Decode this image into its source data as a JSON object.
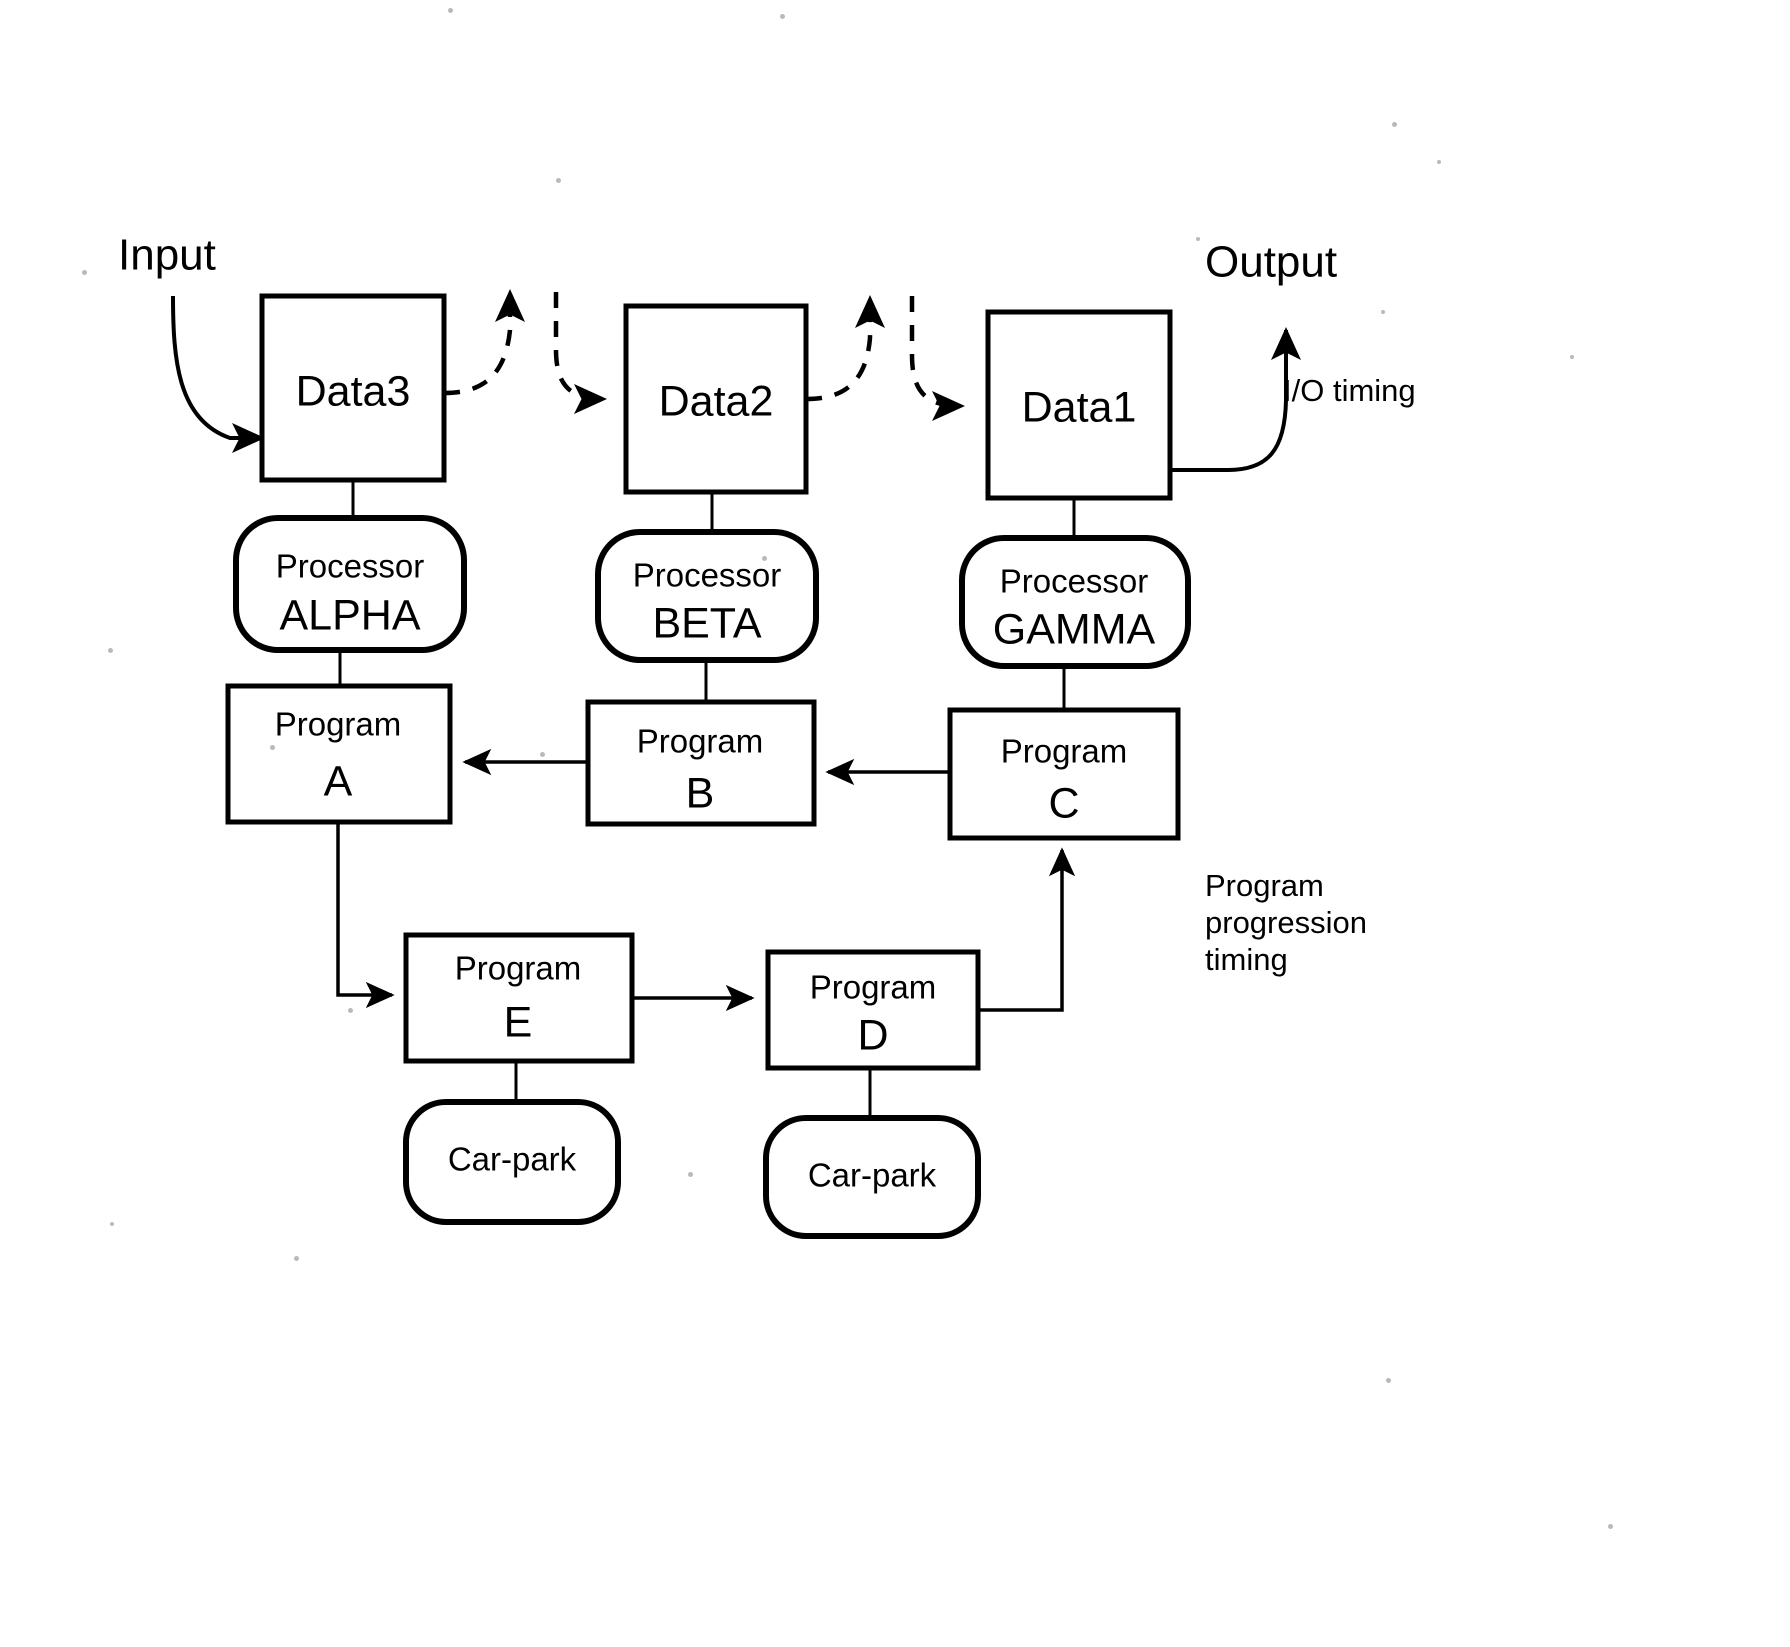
{
  "diagram": {
    "title_labels": {
      "input": "Input",
      "output": "Output",
      "io_timing": "I/O timing",
      "progression_note_line1": "Program",
      "progression_note_line2": "progression",
      "progression_note_line3": "timing"
    },
    "data_nodes": [
      {
        "id": "data3",
        "label": "Data3"
      },
      {
        "id": "data2",
        "label": "Data2"
      },
      {
        "id": "data1",
        "label": "Data1"
      }
    ],
    "processor_nodes": [
      {
        "id": "proc-alpha",
        "title": "Processor",
        "name": "ALPHA"
      },
      {
        "id": "proc-beta",
        "title": "Processor",
        "name": "BETA"
      },
      {
        "id": "proc-gamma",
        "title": "Processor",
        "name": "GAMMA"
      }
    ],
    "program_nodes_top": [
      {
        "id": "prog-a",
        "title": "Program",
        "name": "A"
      },
      {
        "id": "prog-b",
        "title": "Program",
        "name": "B"
      },
      {
        "id": "prog-c",
        "title": "Program",
        "name": "C"
      }
    ],
    "program_nodes_bottom": [
      {
        "id": "prog-e",
        "title": "Program",
        "name": "E"
      },
      {
        "id": "prog-d",
        "title": "Program",
        "name": "D"
      }
    ],
    "carpark_nodes": [
      {
        "id": "carpark-e",
        "label": "Car-park"
      },
      {
        "id": "carpark-d",
        "label": "Car-park"
      }
    ],
    "colors": {
      "ink": "#000000",
      "paper": "#ffffff"
    }
  }
}
